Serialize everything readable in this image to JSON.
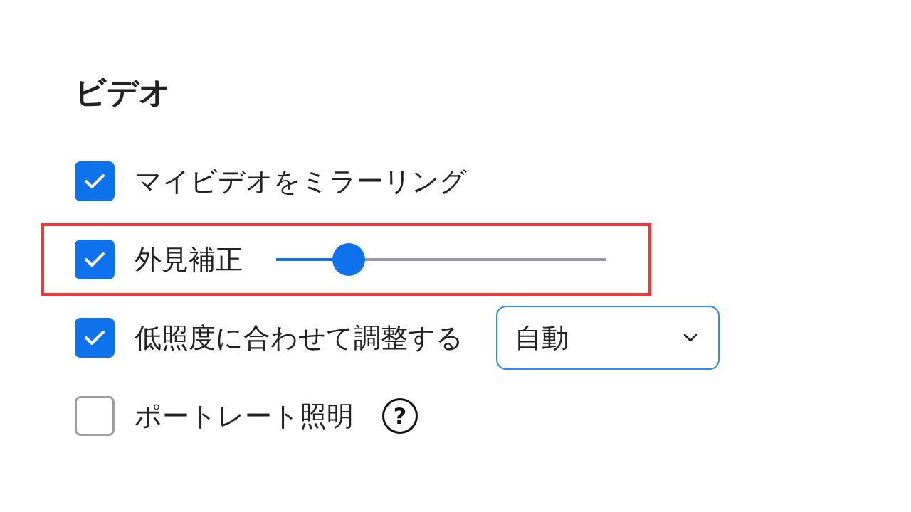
{
  "section": {
    "title": "ビデオ"
  },
  "options": [
    {
      "kind": "plain",
      "label": "マイビデオをミラーリング",
      "checked": true,
      "highlighted": false
    },
    {
      "kind": "slider",
      "label": "外見補正",
      "checked": true,
      "highlighted": true,
      "level": 0.22
    },
    {
      "kind": "dropdown",
      "label": "低照度に合わせて調整する",
      "checked": true,
      "highlighted": false,
      "value": "自動"
    },
    {
      "kind": "help",
      "label": "ポートレート照明",
      "checked": false,
      "highlighted": false,
      "help_icon": "?"
    }
  ]
}
